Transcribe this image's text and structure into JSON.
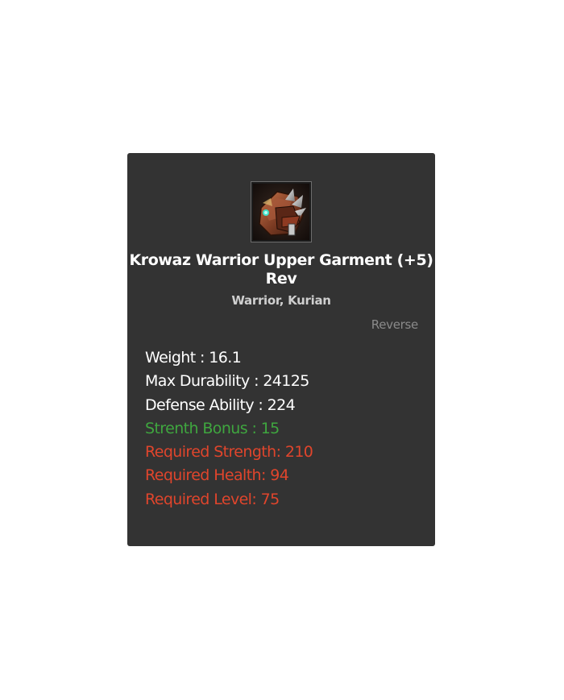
{
  "item": {
    "name": "Krowaz Warrior Upper Garment (+5) Rev",
    "classes": "Warrior, Kurian",
    "icon": "armor-icon",
    "reverse_label": "Reverse"
  },
  "stats": {
    "weight": "Weight : 16.1",
    "max_durability": "Max Durability : 24125",
    "defense_ability": "Defense Ability : 224",
    "strength_bonus": "Strenth Bonus : 15",
    "required_strength": "Required Strength: 210",
    "required_health": "Required Health: 94",
    "required_level": "Required Level: 75"
  },
  "colors": {
    "card_background": "#333333",
    "base_stat": "#ffffff",
    "bonus_stat": "#3fa63f",
    "requirement": "#e0452c",
    "muted": "#8a8a8a"
  }
}
